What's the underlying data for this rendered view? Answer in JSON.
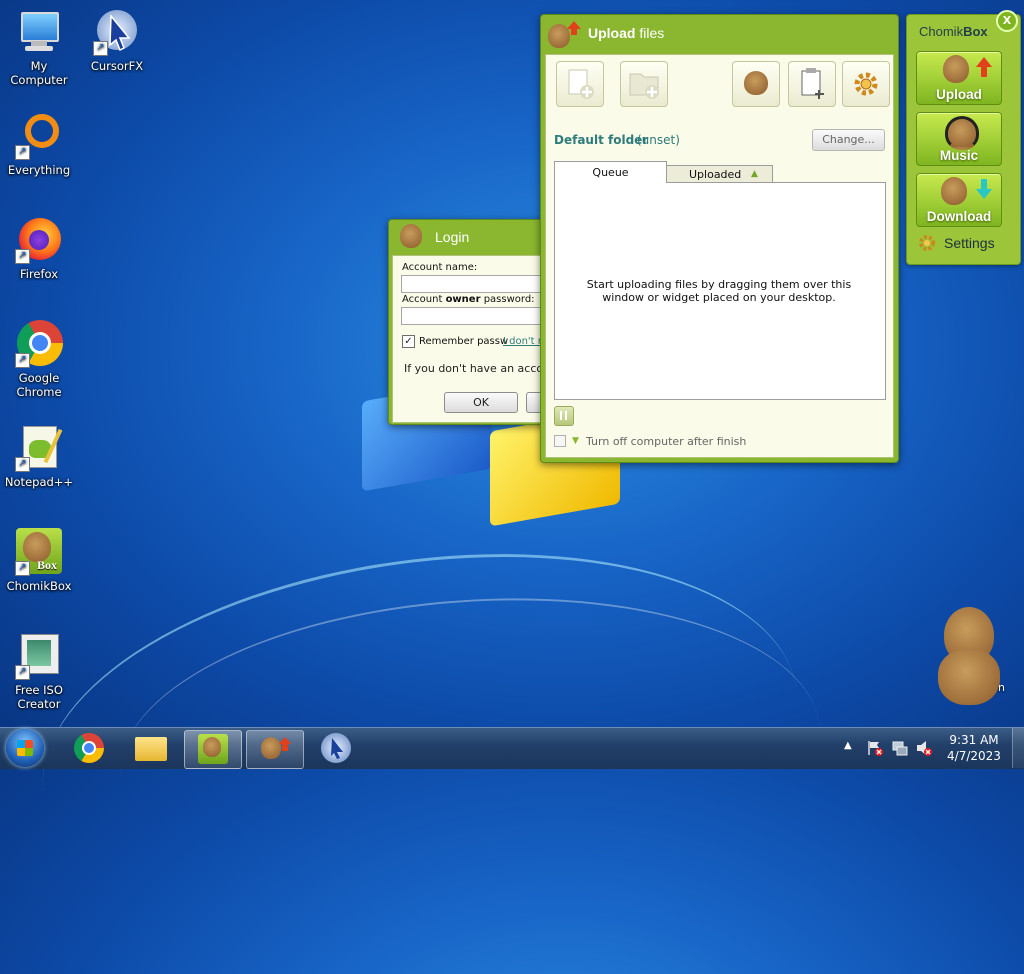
{
  "desktop": {
    "icons": [
      {
        "label": "My Computer",
        "icon": "computer-icon"
      },
      {
        "label": "CursorFX",
        "icon": "cursor-icon"
      },
      {
        "label": "Everything",
        "icon": "search-ring-icon"
      },
      {
        "label": "Firefox",
        "icon": "firefox-icon"
      },
      {
        "label": "Google Chrome",
        "icon": "chrome-icon"
      },
      {
        "label": "Notepad++",
        "icon": "notepad-icon"
      },
      {
        "label": "ChomikBox",
        "icon": "chomikbox-icon"
      },
      {
        "label": "Free ISO Creator",
        "icon": "iso-creator-icon"
      }
    ],
    "mascot_partial_label": "n"
  },
  "login": {
    "title": "Login",
    "account_name_label": "Account name:",
    "password_label_prefix": "Account ",
    "password_label_bold": "owner",
    "password_label_suffix": " password:",
    "remember_label": "Remember passw",
    "forgot_link": "I don't r",
    "remember_checked": true,
    "no_account_text": "If you don't have an accoun",
    "ok_label": "OK"
  },
  "upload": {
    "title_bold": "Upload",
    "title_rest": " files",
    "default_folder_label": "Default folder",
    "default_folder_value": "(unset)",
    "change_label": "Change...",
    "tabs": [
      "Queue",
      "Uploaded"
    ],
    "empty_message": "Start uploading files by dragging them over this window or widget placed on your desktop.",
    "turn_off_label": "Turn off computer after finish"
  },
  "widget": {
    "title_normal": "Chomik",
    "title_bold": "Box",
    "close_label": "X",
    "buttons": [
      "Upload",
      "Music",
      "Download"
    ],
    "settings_label": "Settings"
  },
  "taskbar": {
    "time": "9:31 AM",
    "date": "4/7/2023"
  },
  "colors": {
    "window_green": "#8ab630",
    "panel_cream": "#fbfbe9",
    "accent_teal": "#2d7b7b"
  }
}
